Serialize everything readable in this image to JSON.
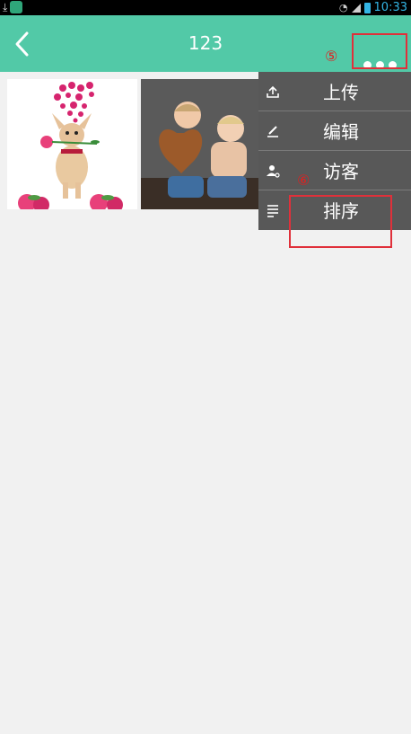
{
  "status_bar": {
    "time": "10:33"
  },
  "app_bar": {
    "title": "123"
  },
  "annotations": {
    "more_marker": "⑤",
    "sort_marker": "⑥"
  },
  "photos": [
    {
      "name": "chihuahua-with-rose"
    },
    {
      "name": "children-with-heart-basket"
    }
  ],
  "menu": {
    "items": [
      {
        "label": "上传",
        "icon": "upload-icon"
      },
      {
        "label": "编辑",
        "icon": "edit-icon"
      },
      {
        "label": "访客",
        "icon": "visitor-icon"
      },
      {
        "label": "排序",
        "icon": "sort-icon"
      }
    ]
  },
  "colors": {
    "app_bar": "#52c9a7",
    "menu_bg": "#585858",
    "highlight": "#e0303a",
    "background": "#f1f1f1"
  }
}
